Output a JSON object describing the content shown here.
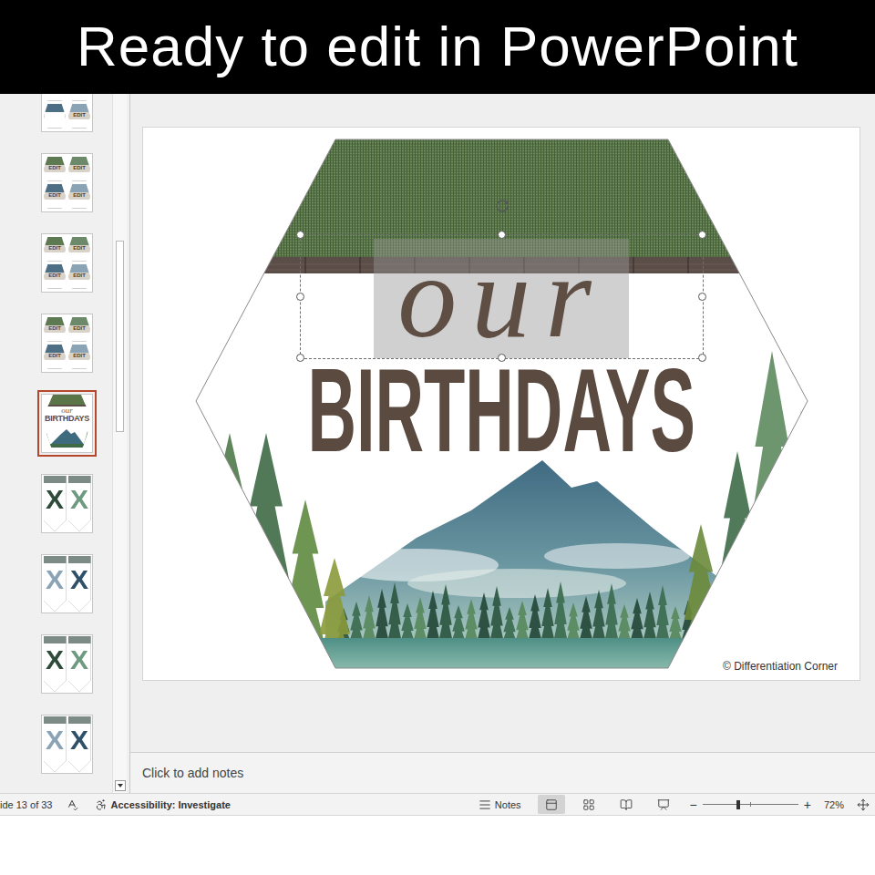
{
  "banner": {
    "text": "Ready to edit in PowerPoint"
  },
  "thumbnail_pane": {
    "scroll_level": 0.3,
    "thumbnails": [
      {
        "kind": "edit-grid",
        "selected": false,
        "labels": [
          "EDIT"
        ]
      },
      {
        "kind": "edit-grid",
        "selected": false,
        "labels": [
          "EDIT",
          "EDIT",
          "EDIT",
          "EDIT"
        ]
      },
      {
        "kind": "edit-grid",
        "selected": false,
        "labels": [
          "EDIT",
          "EDIT",
          "EDIT",
          "EDIT"
        ]
      },
      {
        "kind": "edit-grid",
        "selected": false,
        "labels": [
          "EDIT",
          "EDIT",
          "EDIT",
          "EDIT"
        ]
      },
      {
        "kind": "cover",
        "selected": true,
        "labels": [
          "our",
          "BIRTHDAYS"
        ]
      },
      {
        "kind": "letters",
        "selected": false,
        "pennants": [
          {
            "label": "X",
            "color": "#2f4b3b"
          },
          {
            "label": "X",
            "color": "#6e9a80"
          }
        ]
      },
      {
        "kind": "letters",
        "selected": false,
        "pennants": [
          {
            "label": "X",
            "color": "#8aa3b5"
          },
          {
            "label": "X",
            "color": "#2f5068"
          }
        ]
      },
      {
        "kind": "letters",
        "selected": false,
        "pennants": [
          {
            "label": "X",
            "color": "#2f4b3b"
          },
          {
            "label": "X",
            "color": "#6e9a80"
          }
        ]
      },
      {
        "kind": "letters",
        "selected": false,
        "pennants": [
          {
            "label": "X",
            "color": "#8aa3b5"
          },
          {
            "label": "X",
            "color": "#2f5068"
          }
        ]
      }
    ]
  },
  "slide": {
    "script_title": "our",
    "title": "BIRTHDAYS",
    "copyright": "© Differentiation Corner",
    "script_title_selected": true
  },
  "notes": {
    "placeholder": "Click to add notes"
  },
  "status_bar": {
    "slide_counter": "ide 13 of 33",
    "accessibility": "Accessibility: Investigate",
    "notes_button": "Notes",
    "views": [
      {
        "kind": "normal",
        "selected": true
      },
      {
        "kind": "sorter",
        "selected": false
      },
      {
        "kind": "reading",
        "selected": false
      },
      {
        "kind": "slideshow",
        "selected": false
      }
    ],
    "zoom": {
      "out": "−",
      "in": "+",
      "level": 0.37,
      "reading": "72%"
    }
  }
}
